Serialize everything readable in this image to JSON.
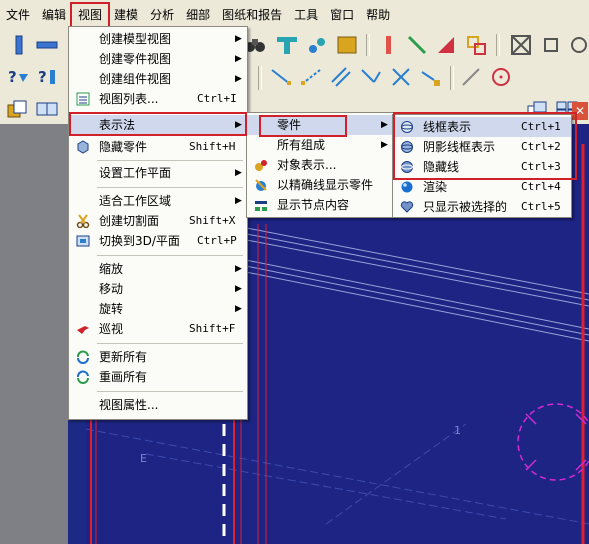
{
  "menubar": {
    "items": [
      "文件",
      "编辑",
      "视图",
      "建模",
      "分析",
      "细部",
      "图纸和报告",
      "工具",
      "窗口",
      "帮助"
    ],
    "active_index": 2
  },
  "view_menu": {
    "items": [
      {
        "label": "创建模型视图",
        "shortcut": "",
        "submenu": true,
        "icon": ""
      },
      {
        "label": "创建零件视图",
        "shortcut": "",
        "submenu": true,
        "icon": ""
      },
      {
        "label": "创建组件视图",
        "shortcut": "",
        "submenu": true,
        "icon": ""
      },
      {
        "label": "视图列表...",
        "shortcut": "Ctrl+I",
        "submenu": false,
        "icon": "view-list-icon"
      },
      {
        "label": "表示法",
        "shortcut": "",
        "submenu": true,
        "icon": ""
      },
      {
        "label": "隐藏零件",
        "shortcut": "Shift+H",
        "submenu": false,
        "icon": "hide-part-icon"
      },
      {
        "label": "设置工作平面",
        "shortcut": "",
        "submenu": true,
        "icon": ""
      },
      {
        "label": "适合工作区域",
        "shortcut": "",
        "submenu": true,
        "icon": ""
      },
      {
        "label": "创建切割面",
        "shortcut": "Shift+X",
        "submenu": false,
        "icon": "scissors-icon"
      },
      {
        "label": "切换到3D/平面",
        "shortcut": "Ctrl+P",
        "submenu": false,
        "icon": "toggle-3d-icon"
      },
      {
        "label": "缩放",
        "shortcut": "",
        "submenu": true,
        "icon": ""
      },
      {
        "label": "移动",
        "shortcut": "",
        "submenu": true,
        "icon": ""
      },
      {
        "label": "旋转",
        "shortcut": "",
        "submenu": true,
        "icon": ""
      },
      {
        "label": "巡视",
        "shortcut": "Shift+F",
        "submenu": false,
        "icon": "fly-icon"
      },
      {
        "label": "更新所有",
        "shortcut": "",
        "submenu": false,
        "icon": "update-icon"
      },
      {
        "label": "重画所有",
        "shortcut": "",
        "submenu": false,
        "icon": "redraw-icon"
      },
      {
        "label": "视图属性...",
        "shortcut": "",
        "submenu": false,
        "icon": ""
      }
    ]
  },
  "repr_menu": {
    "items": [
      {
        "label": "零件",
        "submenu": true,
        "icon": ""
      },
      {
        "label": "所有组成",
        "submenu": true,
        "icon": ""
      },
      {
        "label": "对象表示...",
        "submenu": false,
        "icon": "object-rep-icon"
      },
      {
        "label": "以精确线显示零件",
        "submenu": false,
        "icon": "exact-line-icon"
      },
      {
        "label": "显示节点内容",
        "submenu": false,
        "icon": "node-content-icon"
      }
    ]
  },
  "parts_menu": {
    "items": [
      {
        "label": "线框表示",
        "shortcut": "Ctrl+1",
        "icon": "wireframe-icon"
      },
      {
        "label": "阴影线框表示",
        "shortcut": "Ctrl+2",
        "icon": "shaded-wireframe-icon"
      },
      {
        "label": "隐藏线",
        "shortcut": "Ctrl+3",
        "icon": "hidden-line-icon"
      },
      {
        "label": "渲染",
        "shortcut": "Ctrl+4",
        "icon": "render-icon"
      },
      {
        "label": "只显示被选择的",
        "shortcut": "Ctrl+5",
        "icon": "show-selected-icon"
      }
    ]
  },
  "canvas": {
    "label_e": "E",
    "label_1": "1"
  },
  "colors": {
    "menu_bg": "#fbfbf8",
    "highlight": "#cfd8ec",
    "annotation_red": "#d0202a",
    "canvas_bg": "#1e2484",
    "chrome": "#ece9d8"
  }
}
